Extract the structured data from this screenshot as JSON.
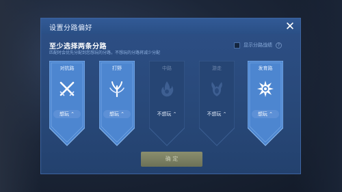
{
  "dialog": {
    "title": "设置分路偏好",
    "heading": "至少选择两条分路",
    "subtext": "匹配时会优先分配到您想玩的分路，不想玩的分路将减少分配",
    "toggle_label": "显示分路战绩",
    "toggle_info": "?",
    "close_glyph": "✕",
    "confirm_label": "确 定"
  },
  "lanes": [
    {
      "name": "对抗路",
      "status": "想玩",
      "selected": true,
      "icon": "crossed-swords-icon"
    },
    {
      "name": "打野",
      "status": "想玩",
      "selected": true,
      "icon": "claw-icon"
    },
    {
      "name": "中路",
      "status": "不想玩",
      "selected": false,
      "icon": "flame-icon"
    },
    {
      "name": "游走",
      "status": "不想玩",
      "selected": false,
      "icon": "horns-icon"
    },
    {
      "name": "发育路",
      "status": "想玩",
      "selected": true,
      "icon": "spiked-orb-icon"
    }
  ],
  "colors": {
    "selected_card": "#4d86d0",
    "unselected_card": "#264574",
    "panel": "#2b4c82",
    "confirm": "#7a7e62"
  }
}
